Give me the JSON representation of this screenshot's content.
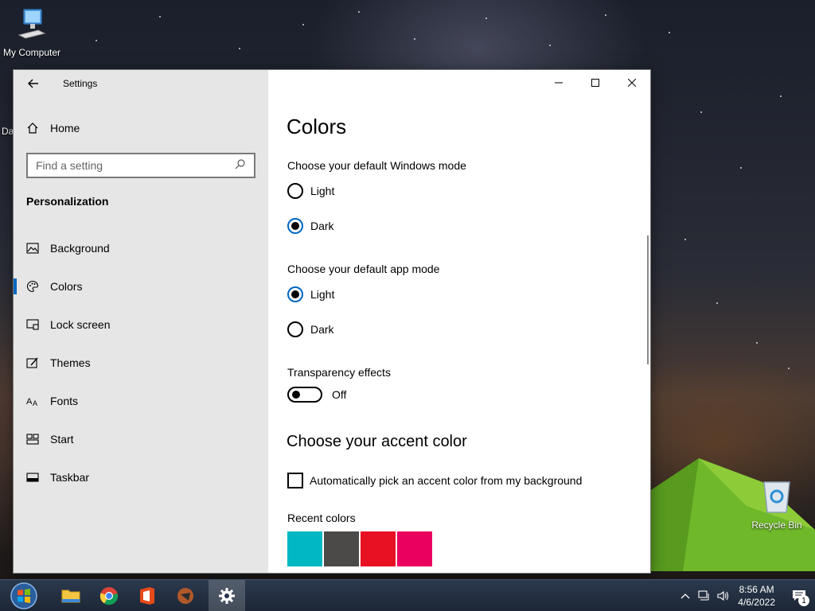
{
  "desktop": {
    "icons": [
      {
        "label": "My Computer",
        "icon": "computer-icon"
      },
      {
        "label": "Recycle Bin",
        "icon": "recycle-bin-icon"
      }
    ],
    "partial_label": "Da"
  },
  "window": {
    "title": "Settings",
    "sidebar": {
      "home_label": "Home",
      "search_placeholder": "Find a setting",
      "section_label": "Personalization",
      "items": [
        {
          "label": "Background",
          "icon": "picture-icon"
        },
        {
          "label": "Colors",
          "icon": "palette-icon",
          "active": true
        },
        {
          "label": "Lock screen",
          "icon": "lock-screen-icon"
        },
        {
          "label": "Themes",
          "icon": "brush-icon"
        },
        {
          "label": "Fonts",
          "icon": "fonts-icon"
        },
        {
          "label": "Start",
          "icon": "start-grid-icon"
        },
        {
          "label": "Taskbar",
          "icon": "taskbar-icon"
        }
      ]
    },
    "content": {
      "title": "Colors",
      "windows_mode": {
        "label": "Choose your default Windows mode",
        "options": [
          "Light",
          "Dark"
        ],
        "selected": "Dark"
      },
      "app_mode": {
        "label": "Choose your default app mode",
        "options": [
          "Light",
          "Dark"
        ],
        "selected": "Light"
      },
      "transparency": {
        "label": "Transparency effects",
        "state": "Off"
      },
      "accent": {
        "title": "Choose your accent color",
        "auto_pick_label": "Automatically pick an accent color from my background",
        "auto_pick_checked": false,
        "recent_label": "Recent colors",
        "recent_colors": [
          "#00b7c3",
          "#4c4a48",
          "#e81123",
          "#ea005e"
        ]
      }
    }
  },
  "taskbar": {
    "apps": [
      "file-explorer-icon",
      "chrome-icon",
      "office-icon",
      "app-icon",
      "settings-gear-icon"
    ],
    "active_app": "settings-gear-icon",
    "clock": {
      "time": "8:56 AM",
      "date": "4/6/2022"
    },
    "notification_count": "1"
  },
  "colors": {
    "accent": "#0067c0",
    "sidebar_bg": "#e6e6e6",
    "taskbar_bg": "#1c2636"
  }
}
